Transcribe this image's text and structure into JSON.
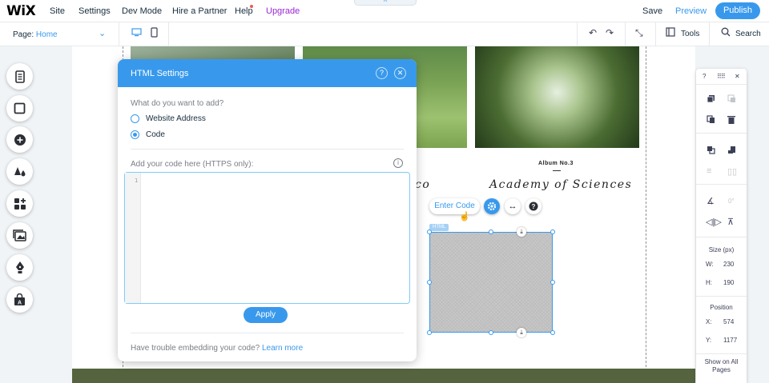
{
  "topbar": {
    "logo": "WiX",
    "menu": [
      "Site",
      "Settings",
      "Dev Mode",
      "Hire a Partner",
      "Help",
      "Upgrade"
    ],
    "save": "Save",
    "preview": "Preview",
    "publish": "Publish",
    "pull_tab": "^"
  },
  "secondary": {
    "page_label": "Page:",
    "page_value": "Home",
    "tools": "Tools",
    "search": "Search"
  },
  "left_tools": [
    "pages-icon",
    "background-icon",
    "add-icon",
    "theme-icon",
    "add-apps-icon",
    "media-icon",
    "blog-icon",
    "store-icon"
  ],
  "site": {
    "album": "Album No.3",
    "title_partial": "co",
    "title": "Academy of Sciences"
  },
  "html_settings": {
    "title": "HTML Settings",
    "question": "What do you want to add?",
    "options": [
      "Website Address",
      "Code"
    ],
    "selected": "Code",
    "code_label": "Add your code here (HTTPS only):",
    "line_number": "1",
    "code_value": "",
    "apply": "Apply",
    "trouble": "Have trouble embedding your code?",
    "learn_more": "Learn more"
  },
  "element": {
    "enter_code": "Enter Code",
    "tag": "HTML"
  },
  "right_panel": {
    "help": "?",
    "size_label": "Size (px)",
    "w_label": "W:",
    "w_value": "230",
    "h_label": "H:",
    "h_value": "190",
    "position_label": "Position",
    "x_label": "X:",
    "x_value": "574",
    "y_label": "Y:",
    "y_value": "1177",
    "rotation": "0°",
    "show_all": "Show on All Pages"
  },
  "colors": {
    "accent": "#3899ec",
    "upgrade": "#9a27d5",
    "band": "#55643f"
  }
}
